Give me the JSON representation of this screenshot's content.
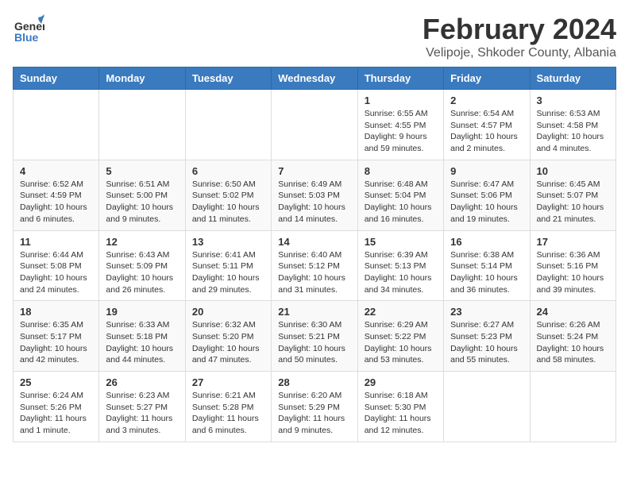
{
  "header": {
    "logo_general": "General",
    "logo_blue": "Blue",
    "title": "February 2024",
    "subtitle": "Velipoje, Shkoder County, Albania"
  },
  "weekdays": [
    "Sunday",
    "Monday",
    "Tuesday",
    "Wednesday",
    "Thursday",
    "Friday",
    "Saturday"
  ],
  "weeks": [
    [
      {
        "day": "",
        "info": ""
      },
      {
        "day": "",
        "info": ""
      },
      {
        "day": "",
        "info": ""
      },
      {
        "day": "",
        "info": ""
      },
      {
        "day": "1",
        "info": "Sunrise: 6:55 AM\nSunset: 4:55 PM\nDaylight: 9 hours and 59 minutes."
      },
      {
        "day": "2",
        "info": "Sunrise: 6:54 AM\nSunset: 4:57 PM\nDaylight: 10 hours and 2 minutes."
      },
      {
        "day": "3",
        "info": "Sunrise: 6:53 AM\nSunset: 4:58 PM\nDaylight: 10 hours and 4 minutes."
      }
    ],
    [
      {
        "day": "4",
        "info": "Sunrise: 6:52 AM\nSunset: 4:59 PM\nDaylight: 10 hours and 6 minutes."
      },
      {
        "day": "5",
        "info": "Sunrise: 6:51 AM\nSunset: 5:00 PM\nDaylight: 10 hours and 9 minutes."
      },
      {
        "day": "6",
        "info": "Sunrise: 6:50 AM\nSunset: 5:02 PM\nDaylight: 10 hours and 11 minutes."
      },
      {
        "day": "7",
        "info": "Sunrise: 6:49 AM\nSunset: 5:03 PM\nDaylight: 10 hours and 14 minutes."
      },
      {
        "day": "8",
        "info": "Sunrise: 6:48 AM\nSunset: 5:04 PM\nDaylight: 10 hours and 16 minutes."
      },
      {
        "day": "9",
        "info": "Sunrise: 6:47 AM\nSunset: 5:06 PM\nDaylight: 10 hours and 19 minutes."
      },
      {
        "day": "10",
        "info": "Sunrise: 6:45 AM\nSunset: 5:07 PM\nDaylight: 10 hours and 21 minutes."
      }
    ],
    [
      {
        "day": "11",
        "info": "Sunrise: 6:44 AM\nSunset: 5:08 PM\nDaylight: 10 hours and 24 minutes."
      },
      {
        "day": "12",
        "info": "Sunrise: 6:43 AM\nSunset: 5:09 PM\nDaylight: 10 hours and 26 minutes."
      },
      {
        "day": "13",
        "info": "Sunrise: 6:41 AM\nSunset: 5:11 PM\nDaylight: 10 hours and 29 minutes."
      },
      {
        "day": "14",
        "info": "Sunrise: 6:40 AM\nSunset: 5:12 PM\nDaylight: 10 hours and 31 minutes."
      },
      {
        "day": "15",
        "info": "Sunrise: 6:39 AM\nSunset: 5:13 PM\nDaylight: 10 hours and 34 minutes."
      },
      {
        "day": "16",
        "info": "Sunrise: 6:38 AM\nSunset: 5:14 PM\nDaylight: 10 hours and 36 minutes."
      },
      {
        "day": "17",
        "info": "Sunrise: 6:36 AM\nSunset: 5:16 PM\nDaylight: 10 hours and 39 minutes."
      }
    ],
    [
      {
        "day": "18",
        "info": "Sunrise: 6:35 AM\nSunset: 5:17 PM\nDaylight: 10 hours and 42 minutes."
      },
      {
        "day": "19",
        "info": "Sunrise: 6:33 AM\nSunset: 5:18 PM\nDaylight: 10 hours and 44 minutes."
      },
      {
        "day": "20",
        "info": "Sunrise: 6:32 AM\nSunset: 5:20 PM\nDaylight: 10 hours and 47 minutes."
      },
      {
        "day": "21",
        "info": "Sunrise: 6:30 AM\nSunset: 5:21 PM\nDaylight: 10 hours and 50 minutes."
      },
      {
        "day": "22",
        "info": "Sunrise: 6:29 AM\nSunset: 5:22 PM\nDaylight: 10 hours and 53 minutes."
      },
      {
        "day": "23",
        "info": "Sunrise: 6:27 AM\nSunset: 5:23 PM\nDaylight: 10 hours and 55 minutes."
      },
      {
        "day": "24",
        "info": "Sunrise: 6:26 AM\nSunset: 5:24 PM\nDaylight: 10 hours and 58 minutes."
      }
    ],
    [
      {
        "day": "25",
        "info": "Sunrise: 6:24 AM\nSunset: 5:26 PM\nDaylight: 11 hours and 1 minute."
      },
      {
        "day": "26",
        "info": "Sunrise: 6:23 AM\nSunset: 5:27 PM\nDaylight: 11 hours and 3 minutes."
      },
      {
        "day": "27",
        "info": "Sunrise: 6:21 AM\nSunset: 5:28 PM\nDaylight: 11 hours and 6 minutes."
      },
      {
        "day": "28",
        "info": "Sunrise: 6:20 AM\nSunset: 5:29 PM\nDaylight: 11 hours and 9 minutes."
      },
      {
        "day": "29",
        "info": "Sunrise: 6:18 AM\nSunset: 5:30 PM\nDaylight: 11 hours and 12 minutes."
      },
      {
        "day": "",
        "info": ""
      },
      {
        "day": "",
        "info": ""
      }
    ]
  ]
}
